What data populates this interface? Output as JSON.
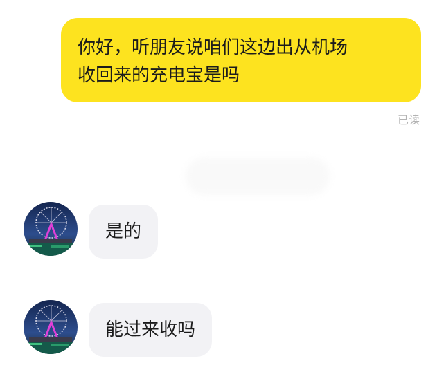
{
  "messages": [
    {
      "direction": "outgoing",
      "text": "你好，听朋友说咱们这边出从机场\n收回来的充电宝是吗",
      "status": "已读"
    },
    {
      "direction": "incoming",
      "text": "是的",
      "avatar_icon": "ferris-wheel-night-avatar"
    },
    {
      "direction": "incoming",
      "text": "能过来收吗",
      "avatar_icon": "ferris-wheel-night-avatar"
    }
  ],
  "colors": {
    "outgoing_bubble": "#fde31f",
    "incoming_bubble": "#f2f2f5",
    "text": "#1c1c1c",
    "read_receipt": "#b3b3b3"
  }
}
